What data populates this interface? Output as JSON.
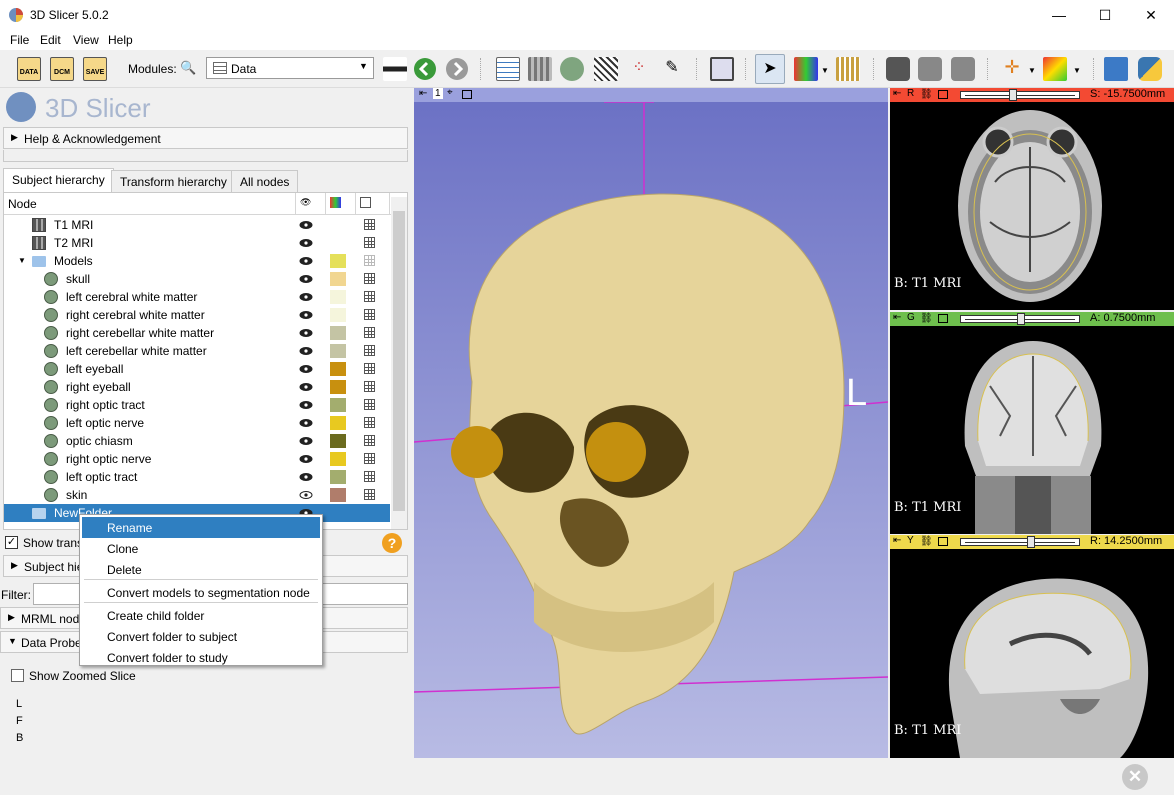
{
  "window": {
    "title": "3D Slicer 5.0.2",
    "minimize": "—",
    "maximize": "☐",
    "close": "✕"
  },
  "menu": [
    "File",
    "Edit",
    "View",
    "Help"
  ],
  "toolbar": {
    "data_label": "DATA",
    "dcm_label": "DCM",
    "save_label": "SAVE",
    "modules_label": "Modules:",
    "module_value": "Data"
  },
  "left": {
    "brand": "3D Slicer",
    "help_section": "Help & Acknowledgement",
    "tabs": [
      "Subject hierarchy",
      "Transform hierarchy",
      "All nodes"
    ],
    "tree_header": "Node",
    "tree_rows": [
      {
        "name": "T1 MRI",
        "icon": "volume-icon",
        "color": ""
      },
      {
        "name": "T2 MRI",
        "icon": "volume-icon",
        "color": ""
      },
      {
        "name": "Models",
        "icon": "folder-icon",
        "color": "#e5e05a"
      },
      {
        "name": "skull",
        "icon": "model-icon",
        "color": "#f1d691"
      },
      {
        "name": "left cerebral white matter",
        "icon": "model-icon",
        "color": "#f5f5dc"
      },
      {
        "name": "right cerebral white matter",
        "icon": "model-icon",
        "color": "#f5f5dc"
      },
      {
        "name": "right cerebellar white matter",
        "icon": "model-icon",
        "color": "#c4c4a4"
      },
      {
        "name": "left cerebellar white matter",
        "icon": "model-icon",
        "color": "#c4c4a4"
      },
      {
        "name": "left eyeball",
        "icon": "model-icon",
        "color": "#c8900f"
      },
      {
        "name": "right eyeball",
        "icon": "model-icon",
        "color": "#c8900f"
      },
      {
        "name": "right optic tract",
        "icon": "model-icon",
        "color": "#a3ad6e"
      },
      {
        "name": "left optic nerve",
        "icon": "model-icon",
        "color": "#e8c920"
      },
      {
        "name": "optic chiasm",
        "icon": "model-icon",
        "color": "#6b6b1f"
      },
      {
        "name": "right optic nerve",
        "icon": "model-icon",
        "color": "#e8c920"
      },
      {
        "name": "left optic tract",
        "icon": "model-icon",
        "color": "#a3ad6e"
      },
      {
        "name": "skin",
        "icon": "model-icon",
        "color": "#b07d6b"
      },
      {
        "name": "NewFolder",
        "icon": "folder-icon",
        "color": ""
      }
    ],
    "show_transforms": "Show transforms",
    "subject_hier": "Subject hierarchy",
    "filter_label": "Filter:",
    "mrml_node": "MRML node information",
    "data_probe": "Data Probe",
    "show_zoomed": "Show Zoomed Slice",
    "probe_lines": [
      "L",
      "F",
      "B"
    ]
  },
  "context_menu": [
    "Rename",
    "Clone",
    "Delete",
    "Convert models to segmentation node",
    "Create child folder",
    "Convert folder to subject",
    "Convert folder to study"
  ],
  "view3d": {
    "label": "1",
    "orientation": "L"
  },
  "slices": [
    {
      "name": "R",
      "offset": "S: -15.7500mm",
      "label": "B: T1 MRI",
      "color": "#f34a33",
      "slider": 0.42
    },
    {
      "name": "G",
      "offset": "A: 0.7500mm",
      "label": "B: T1 MRI",
      "color": "#6ebf4d",
      "slider": 0.5
    },
    {
      "name": "Y",
      "offset": "R: 14.2500mm",
      "label": "B: T1 MRI",
      "color": "#eed94c",
      "slider": 0.6
    }
  ]
}
